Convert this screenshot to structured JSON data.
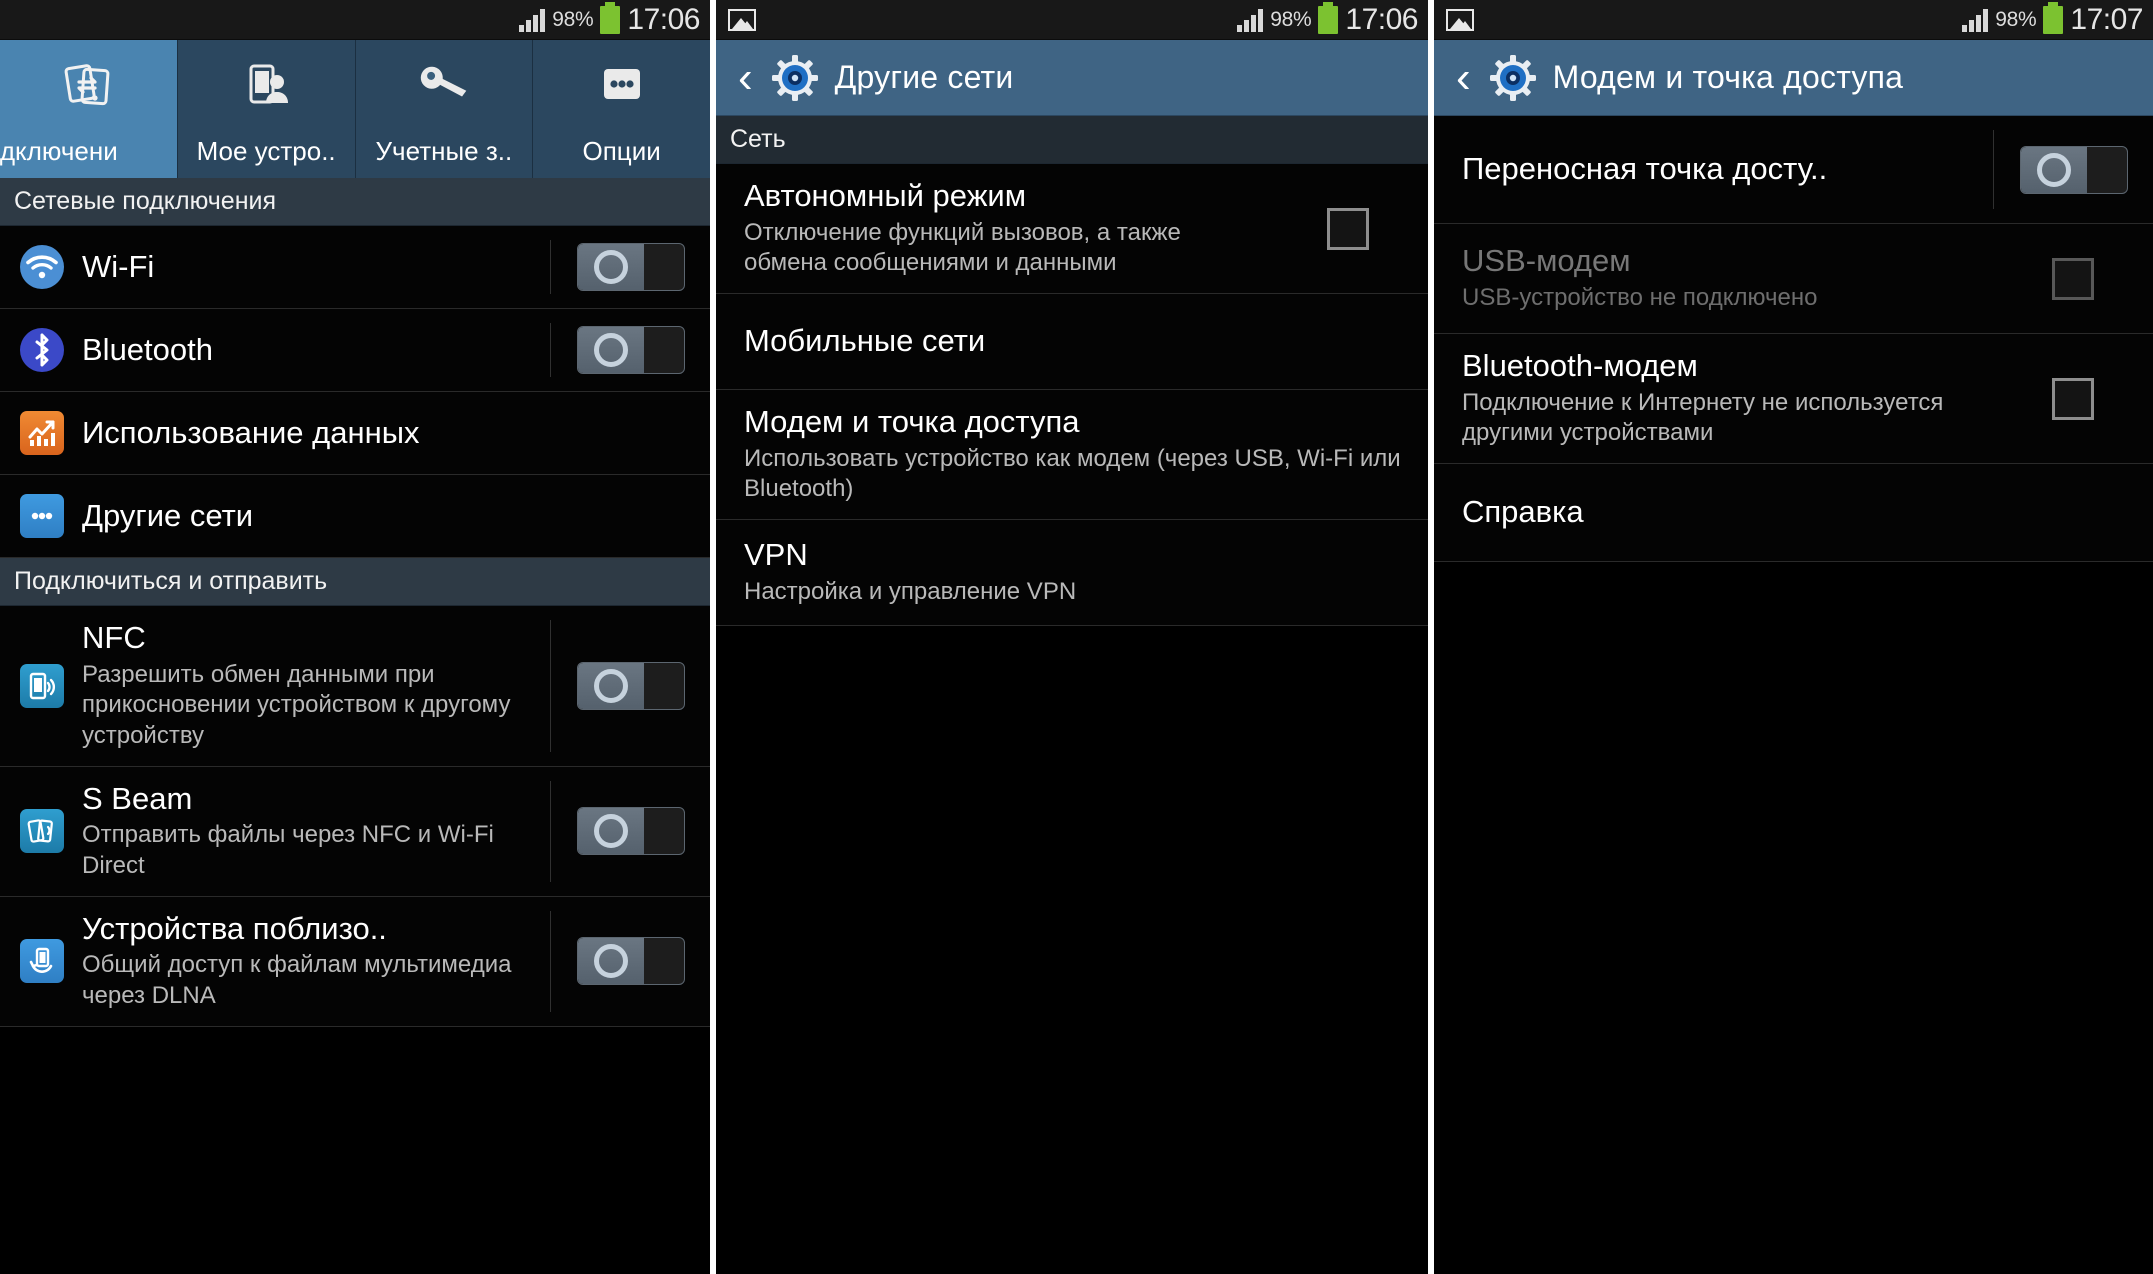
{
  "statusbar": {
    "battery_percent": "98%",
    "time_p1": "17:06",
    "time_p2": "17:06",
    "time_p3": "17:07",
    "signal_icon": "signal-bars-icon",
    "battery_icon": "battery-icon",
    "image_icon": "image-notification-icon",
    "battery_color": "#7cc230"
  },
  "panel1": {
    "tabs": [
      {
        "label": "одключени",
        "icon": "connections-icon",
        "active": true
      },
      {
        "label": "Мое устро..",
        "icon": "my-device-icon",
        "active": false
      },
      {
        "label": "Учетные з..",
        "icon": "accounts-key-icon",
        "active": false
      },
      {
        "label": "Опции",
        "icon": "more-options-icon",
        "active": false
      }
    ],
    "sections": [
      {
        "header": "Сетевые подключения",
        "items": [
          {
            "title": "Wi-Fi",
            "sub": "",
            "icon": "wifi-icon",
            "control": "toggle",
            "state": "off"
          },
          {
            "title": "Bluetooth",
            "sub": "",
            "icon": "bluetooth-icon",
            "control": "toggle",
            "state": "off"
          },
          {
            "title": "Использование данных",
            "sub": "",
            "icon": "data-usage-icon",
            "control": "none"
          },
          {
            "title": "Другие сети",
            "sub": "",
            "icon": "more-networks-icon",
            "control": "none"
          }
        ]
      },
      {
        "header": "Подключиться и отправить",
        "items": [
          {
            "title": "NFC",
            "sub": "Разрешить обмен данными при прикосновении устройством к другому устройству",
            "icon": "nfc-icon",
            "control": "toggle",
            "state": "off"
          },
          {
            "title": "S Beam",
            "sub": "Отправить файлы через NFC и Wi-Fi Direct",
            "icon": "s-beam-icon",
            "control": "toggle",
            "state": "off"
          },
          {
            "title": "Устройства поблизо..",
            "sub": "Общий доступ к файлам мультимедиа через DLNA",
            "icon": "nearby-devices-icon",
            "control": "toggle",
            "state": "off"
          }
        ]
      }
    ]
  },
  "panel2": {
    "title": "Другие сети",
    "back_icon": "back-chevron-icon",
    "app_icon": "settings-gear-icon",
    "section_header": "Сеть",
    "items": [
      {
        "title": "Автономный режим",
        "sub": "Отключение функций вызовов, а также обмена сообщениями и данными",
        "control": "checkbox",
        "state": "unchecked"
      },
      {
        "title": "Мобильные сети",
        "sub": "",
        "control": "none"
      },
      {
        "title": "Модем и точка доступа",
        "sub": "Использовать устройство как модем (через USB, Wi-Fi или Bluetooth)",
        "control": "none"
      },
      {
        "title": "VPN",
        "sub": "Настройка и управление VPN",
        "control": "none"
      }
    ]
  },
  "panel3": {
    "title": "Модем и точка доступа",
    "back_icon": "back-chevron-icon",
    "app_icon": "settings-gear-icon",
    "items": [
      {
        "title": "Переносная точка досту..",
        "sub": "",
        "control": "toggle",
        "state": "off",
        "disabled": false
      },
      {
        "title": "USB-модем",
        "sub": "USB-устройство не подключено",
        "control": "checkbox",
        "state": "unchecked",
        "disabled": true
      },
      {
        "title": "Bluetooth-модем",
        "sub": "Подключение к Интернету не используется другими устройствами",
        "control": "checkbox",
        "state": "unchecked",
        "disabled": false
      },
      {
        "title": "Справка",
        "sub": "",
        "control": "none",
        "disabled": false
      }
    ]
  },
  "colors": {
    "accent_blue": "#4a84b0",
    "actionbar_blue": "#3f6484",
    "tabbar_blue": "#2b475f",
    "section_gray": "#2e3a45",
    "list_bg": "#040404"
  }
}
